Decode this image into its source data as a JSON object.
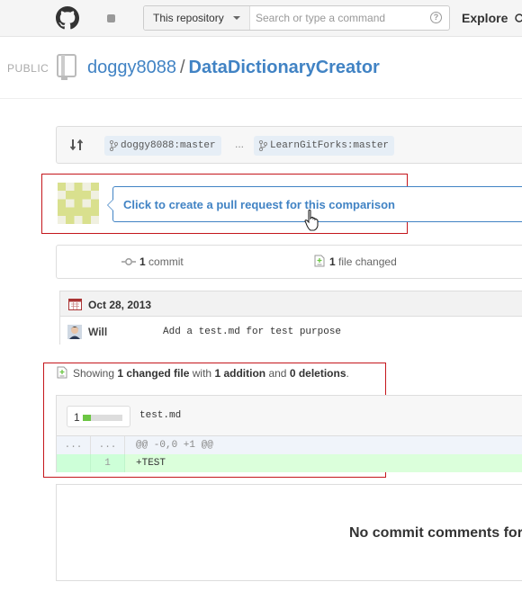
{
  "header": {
    "search_scope": "This repository",
    "search_placeholder": "Search or type a command",
    "help_symbol": "?",
    "nav_explore": "Explore"
  },
  "repo": {
    "visibility": "PUBLIC",
    "owner": "doggy8088",
    "separator": "/",
    "name": "DataDictionaryCreator"
  },
  "compare": {
    "base_branch": "doggy8088:master",
    "range_dots": "...",
    "head_branch": "LearnGitForks:master"
  },
  "pull_request": {
    "prompt": "Click to create a pull request for this comparison"
  },
  "stats": {
    "commits_count": "1",
    "commits_label": "commit",
    "files_count": "1",
    "files_label": "file changed"
  },
  "commits": {
    "date": "Oct 28, 2013",
    "rows": [
      {
        "author": "Will",
        "message": "Add a test.md for test purpose"
      }
    ]
  },
  "summary": {
    "prefix": "Showing",
    "changed_files": "1 changed file",
    "with": "with",
    "additions": "1 addition",
    "and": "and",
    "deletions": "0 deletions",
    "suffix": "."
  },
  "diff": {
    "diffstat_count": "1",
    "additions_fraction": 0.2,
    "file_name": "test.md",
    "hunk": {
      "old_num": "...",
      "new_num": "...",
      "text": "@@ -0,0 +1 @@"
    },
    "lines": [
      {
        "old_num": "",
        "new_num": "1",
        "text": "+TEST"
      }
    ]
  },
  "comments": {
    "empty_text": "No commit comments for"
  },
  "colors": {
    "link": "#4183c4",
    "highlight_border": "#c4161c",
    "addition": "#6cc644",
    "added_line_bg": "#dbffdb"
  }
}
